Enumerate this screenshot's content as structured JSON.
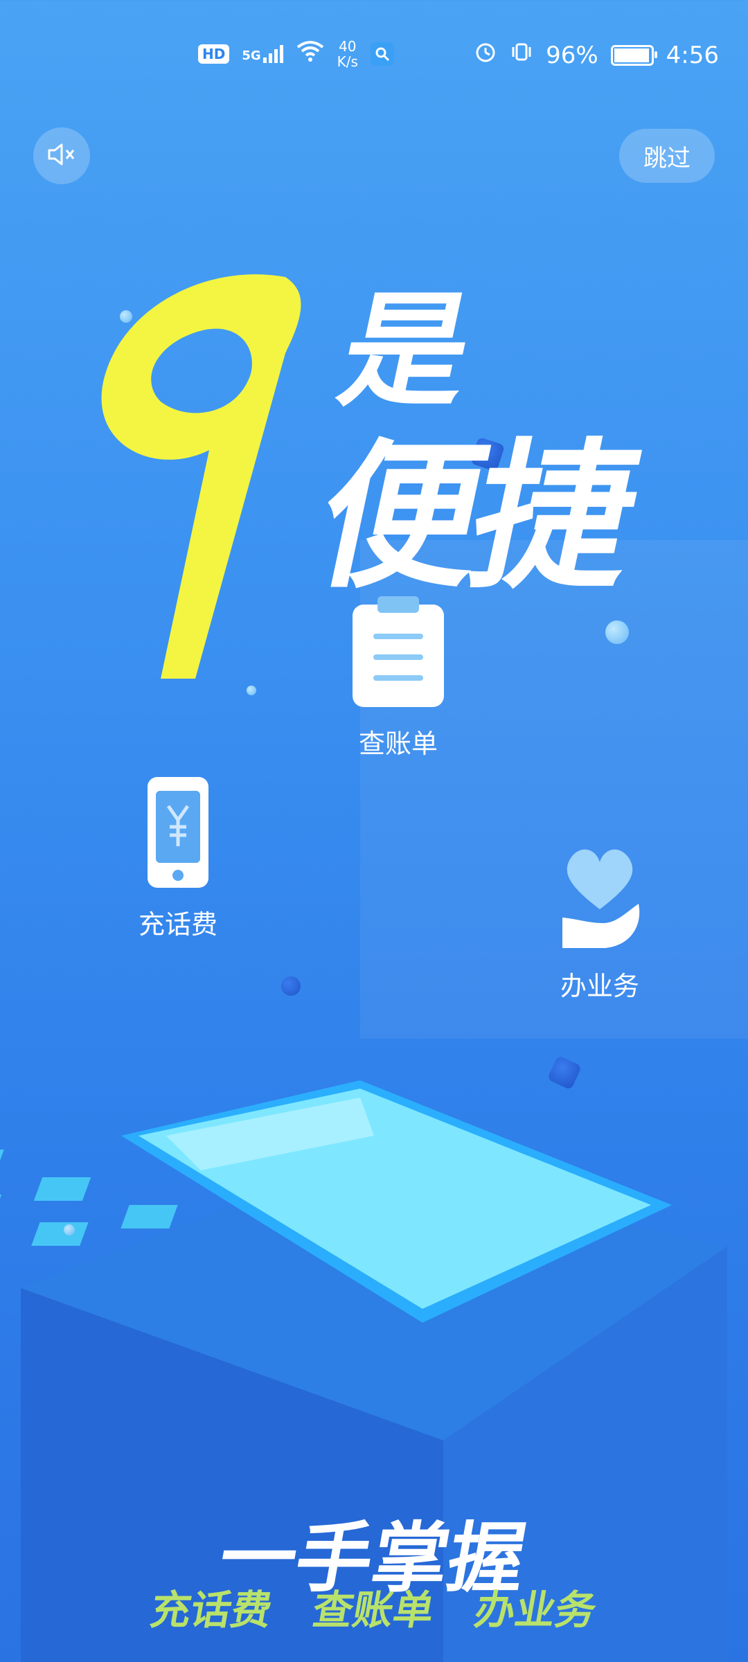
{
  "status_bar": {
    "left_badges": [
      "HD",
      "5G"
    ],
    "net_rate_value": "40",
    "net_rate_unit": "K/s",
    "icons": [
      "hd-icon",
      "5g-signal-icon",
      "wifi-icon",
      "search-badge-icon",
      "alarm-icon",
      "vibrate-icon",
      "battery-icon"
    ],
    "battery_percent": "96%",
    "time": "4:56"
  },
  "controls": {
    "mute_icon": "mute-icon",
    "skip_label": "跳过"
  },
  "hero": {
    "number": "9",
    "slogan_line1": "是",
    "slogan_line2": "便捷"
  },
  "features": [
    {
      "label": "查账单",
      "icon": "bill-icon"
    },
    {
      "label": "充话费",
      "icon": "phone-recharge-icon"
    },
    {
      "label": "办业务",
      "icon": "heart-hand-icon"
    }
  ],
  "bottom": {
    "title": "一手掌握",
    "items": [
      "充话费",
      "查账单",
      "办业务"
    ]
  },
  "colors": {
    "bg_top": "#4aa3f4",
    "bg_bottom": "#2a73e3",
    "accent_yellow": "#f3f542",
    "accent_green": "#b9e26b"
  }
}
